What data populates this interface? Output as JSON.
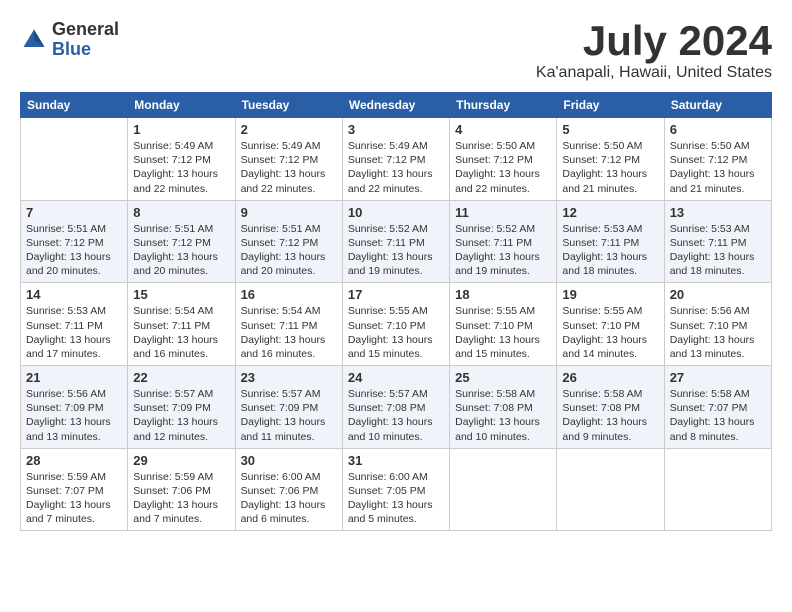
{
  "header": {
    "logo_general": "General",
    "logo_blue": "Blue",
    "month_title": "July 2024",
    "location": "Ka'anapali, Hawaii, United States"
  },
  "days_of_week": [
    "Sunday",
    "Monday",
    "Tuesday",
    "Wednesday",
    "Thursday",
    "Friday",
    "Saturday"
  ],
  "weeks": [
    [
      {
        "day": "",
        "info": ""
      },
      {
        "day": "1",
        "info": "Sunrise: 5:49 AM\nSunset: 7:12 PM\nDaylight: 13 hours\nand 22 minutes."
      },
      {
        "day": "2",
        "info": "Sunrise: 5:49 AM\nSunset: 7:12 PM\nDaylight: 13 hours\nand 22 minutes."
      },
      {
        "day": "3",
        "info": "Sunrise: 5:49 AM\nSunset: 7:12 PM\nDaylight: 13 hours\nand 22 minutes."
      },
      {
        "day": "4",
        "info": "Sunrise: 5:50 AM\nSunset: 7:12 PM\nDaylight: 13 hours\nand 22 minutes."
      },
      {
        "day": "5",
        "info": "Sunrise: 5:50 AM\nSunset: 7:12 PM\nDaylight: 13 hours\nand 21 minutes."
      },
      {
        "day": "6",
        "info": "Sunrise: 5:50 AM\nSunset: 7:12 PM\nDaylight: 13 hours\nand 21 minutes."
      }
    ],
    [
      {
        "day": "7",
        "info": "Sunrise: 5:51 AM\nSunset: 7:12 PM\nDaylight: 13 hours\nand 20 minutes."
      },
      {
        "day": "8",
        "info": "Sunrise: 5:51 AM\nSunset: 7:12 PM\nDaylight: 13 hours\nand 20 minutes."
      },
      {
        "day": "9",
        "info": "Sunrise: 5:51 AM\nSunset: 7:12 PM\nDaylight: 13 hours\nand 20 minutes."
      },
      {
        "day": "10",
        "info": "Sunrise: 5:52 AM\nSunset: 7:11 PM\nDaylight: 13 hours\nand 19 minutes."
      },
      {
        "day": "11",
        "info": "Sunrise: 5:52 AM\nSunset: 7:11 PM\nDaylight: 13 hours\nand 19 minutes."
      },
      {
        "day": "12",
        "info": "Sunrise: 5:53 AM\nSunset: 7:11 PM\nDaylight: 13 hours\nand 18 minutes."
      },
      {
        "day": "13",
        "info": "Sunrise: 5:53 AM\nSunset: 7:11 PM\nDaylight: 13 hours\nand 18 minutes."
      }
    ],
    [
      {
        "day": "14",
        "info": "Sunrise: 5:53 AM\nSunset: 7:11 PM\nDaylight: 13 hours\nand 17 minutes."
      },
      {
        "day": "15",
        "info": "Sunrise: 5:54 AM\nSunset: 7:11 PM\nDaylight: 13 hours\nand 16 minutes."
      },
      {
        "day": "16",
        "info": "Sunrise: 5:54 AM\nSunset: 7:11 PM\nDaylight: 13 hours\nand 16 minutes."
      },
      {
        "day": "17",
        "info": "Sunrise: 5:55 AM\nSunset: 7:10 PM\nDaylight: 13 hours\nand 15 minutes."
      },
      {
        "day": "18",
        "info": "Sunrise: 5:55 AM\nSunset: 7:10 PM\nDaylight: 13 hours\nand 15 minutes."
      },
      {
        "day": "19",
        "info": "Sunrise: 5:55 AM\nSunset: 7:10 PM\nDaylight: 13 hours\nand 14 minutes."
      },
      {
        "day": "20",
        "info": "Sunrise: 5:56 AM\nSunset: 7:10 PM\nDaylight: 13 hours\nand 13 minutes."
      }
    ],
    [
      {
        "day": "21",
        "info": "Sunrise: 5:56 AM\nSunset: 7:09 PM\nDaylight: 13 hours\nand 13 minutes."
      },
      {
        "day": "22",
        "info": "Sunrise: 5:57 AM\nSunset: 7:09 PM\nDaylight: 13 hours\nand 12 minutes."
      },
      {
        "day": "23",
        "info": "Sunrise: 5:57 AM\nSunset: 7:09 PM\nDaylight: 13 hours\nand 11 minutes."
      },
      {
        "day": "24",
        "info": "Sunrise: 5:57 AM\nSunset: 7:08 PM\nDaylight: 13 hours\nand 10 minutes."
      },
      {
        "day": "25",
        "info": "Sunrise: 5:58 AM\nSunset: 7:08 PM\nDaylight: 13 hours\nand 10 minutes."
      },
      {
        "day": "26",
        "info": "Sunrise: 5:58 AM\nSunset: 7:08 PM\nDaylight: 13 hours\nand 9 minutes."
      },
      {
        "day": "27",
        "info": "Sunrise: 5:58 AM\nSunset: 7:07 PM\nDaylight: 13 hours\nand 8 minutes."
      }
    ],
    [
      {
        "day": "28",
        "info": "Sunrise: 5:59 AM\nSunset: 7:07 PM\nDaylight: 13 hours\nand 7 minutes."
      },
      {
        "day": "29",
        "info": "Sunrise: 5:59 AM\nSunset: 7:06 PM\nDaylight: 13 hours\nand 7 minutes."
      },
      {
        "day": "30",
        "info": "Sunrise: 6:00 AM\nSunset: 7:06 PM\nDaylight: 13 hours\nand 6 minutes."
      },
      {
        "day": "31",
        "info": "Sunrise: 6:00 AM\nSunset: 7:05 PM\nDaylight: 13 hours\nand 5 minutes."
      },
      {
        "day": "",
        "info": ""
      },
      {
        "day": "",
        "info": ""
      },
      {
        "day": "",
        "info": ""
      }
    ]
  ]
}
